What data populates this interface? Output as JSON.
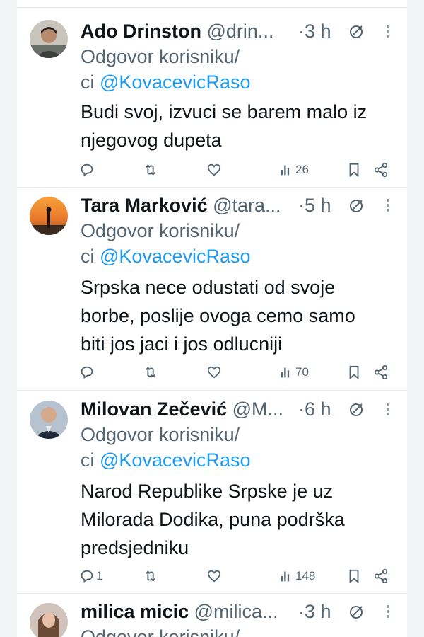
{
  "reply_prefix_line1": "Odgovor korisniku/",
  "reply_prefix_line2": "ci",
  "colors": {
    "accent": "#1d9bf0",
    "muted": "#536471",
    "text": "#0f1419"
  },
  "tweets": [
    {
      "name": "Ado Drinston",
      "handle": "@drin...",
      "time": "·3 h",
      "reply_to": "@KovacevicRaso",
      "text_lines": [
        "Budi svoj, izvuci se barem malo iz",
        "njegovog dupeta"
      ],
      "replies": "",
      "views": "26"
    },
    {
      "name": "Tara Marković",
      "handle": "@tara...",
      "time": "·5 h",
      "reply_to": "@KovacevicRaso",
      "text_lines": [
        "Srpska nece odustati od svoje",
        "borbe, poslije ovoga cemo samo",
        "biti jos jaci i jos odlucniji"
      ],
      "replies": "",
      "views": "70"
    },
    {
      "name": "Milovan Zečević",
      "handle": "@M...",
      "time": "·6 h",
      "reply_to": "@KovacevicRaso",
      "text_lines": [
        "Narod Republike Srpske je uz",
        "Milorada Dodika, puna podrška",
        "predsjedniku"
      ],
      "replies": "1",
      "views": "148"
    },
    {
      "name": "milica micic",
      "handle": "@milica...",
      "time": "·3 h",
      "reply_to": "",
      "text_lines": [],
      "replies": "",
      "views": ""
    }
  ],
  "icons": {
    "reply": "reply-icon",
    "retweet": "retweet-icon",
    "like": "like-icon",
    "views": "views-icon",
    "bookmark": "bookmark-icon",
    "share": "share-icon",
    "mute": "mute-icon",
    "more": "more-icon"
  }
}
